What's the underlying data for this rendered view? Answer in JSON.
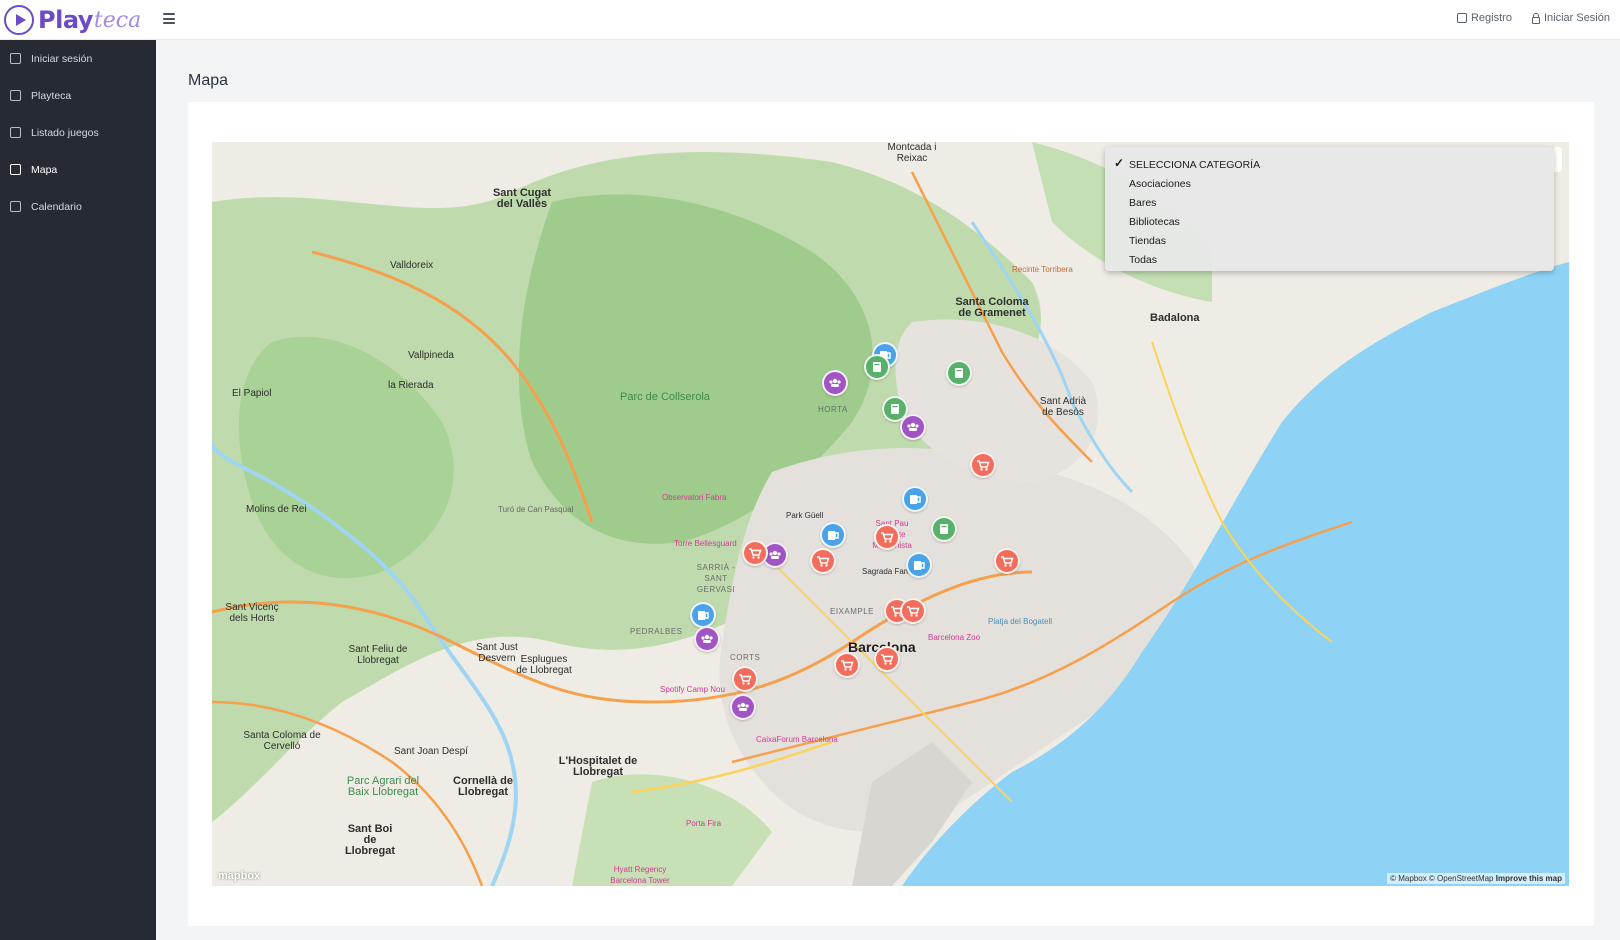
{
  "app": {
    "logo_play": "Play",
    "logo_teca": "teca"
  },
  "topbar": {
    "registro": "Registro",
    "iniciar_sesion": "Iniciar Sesión"
  },
  "sidebar": {
    "items": [
      {
        "label": "Iniciar sesión",
        "icon": "lock-icon"
      },
      {
        "label": "Playteca",
        "icon": "home-icon"
      },
      {
        "label": "Listado juegos",
        "icon": "grid-icon"
      },
      {
        "label": "Mapa",
        "icon": "map-icon",
        "active": true
      },
      {
        "label": "Calendario",
        "icon": "calendar-icon"
      }
    ]
  },
  "page": {
    "title": "Mapa"
  },
  "map": {
    "category_select": {
      "options": [
        "SELECCIONA CATEGORÍA",
        "Asociaciones",
        "Bares",
        "Bibliotecas",
        "Tiendas",
        "Todas"
      ],
      "selected": "SELECCIONA CATEGORÍA"
    },
    "labels": {
      "barcelona": "Barcelona",
      "badalona": "Badalona",
      "santa_coloma_gramenet": "Santa Coloma de Gramenet",
      "sant_cugat": "Sant Cugat del Vallès",
      "hospitalet": "L'Hospitalet de Llobregat",
      "cornella": "Cornellà de Llobregat",
      "sant_boi": "Sant Boi de Llobregat",
      "esplugues": "Esplugues de Llobregat",
      "sant_just": "Sant Just Desvern",
      "sant_feliu": "Sant Feliu de Llobregat",
      "sant_joan_despi": "Sant Joan Despí",
      "molins": "Molins de Rei",
      "el_papiol": "El Papiol",
      "sant_vicenc": "Sant Vicenç dels Horts",
      "santa_coloma_cervello": "Santa Coloma de Cervelló",
      "sant_adria": "Sant Adrià de Besòs",
      "montcada": "Montcada i Reixac",
      "collserola": "Parc de Collserola",
      "parc_agrari": "Parc Agrari del Baix Llobregat",
      "valldoreix": "Valldoreix",
      "vallpineda": "Vallpineda",
      "la_rierada": "la Rierada",
      "eixample": "EIXAMPLE",
      "horta": "HORTA",
      "corts": "CORTS",
      "pedralbes": "PEDRALBES",
      "sarria": "SARRIÀ - SANT GERVASI",
      "park_guell": "Park Güell",
      "sagrada_familia": "Sagrada Família",
      "barcelona_zoo": "Barcelona Zoo",
      "spotify_camp_nou": "Spotify Camp Nou",
      "caixaforum": "CaixaForum Barcelona",
      "torre_bellesguard": "Torre Bellesguard",
      "observatori": "Observatori Fabra",
      "sant_pau": "Sant Pau Recinte Modernista",
      "hyatt": "Hyatt Regency Barcelona Tower",
      "porta_fira": "Porta Fira",
      "turo": "Turó de Can Pasqual",
      "platja": "Platja del Bogatell",
      "recinte": "Recinte Torribera"
    },
    "attribution": "© Mapbox © OpenStreetMap",
    "improve": "Improve this map",
    "mapbox_logo": "mapbox",
    "markers": [
      {
        "type": "tienda",
        "icon": "cart-icon"
      },
      {
        "type": "asociacion",
        "icon": "group-icon"
      },
      {
        "type": "bar",
        "icon": "beer-icon"
      },
      {
        "type": "biblioteca",
        "icon": "book-icon"
      }
    ]
  },
  "colors": {
    "sidebar_bg": "#262b33",
    "brand": "#6b4bc7",
    "tienda": "#f26d5b",
    "asociacion": "#a154c3",
    "bar": "#4aa3e8",
    "biblioteca": "#58b06a",
    "sea": "#8ed3f5"
  }
}
